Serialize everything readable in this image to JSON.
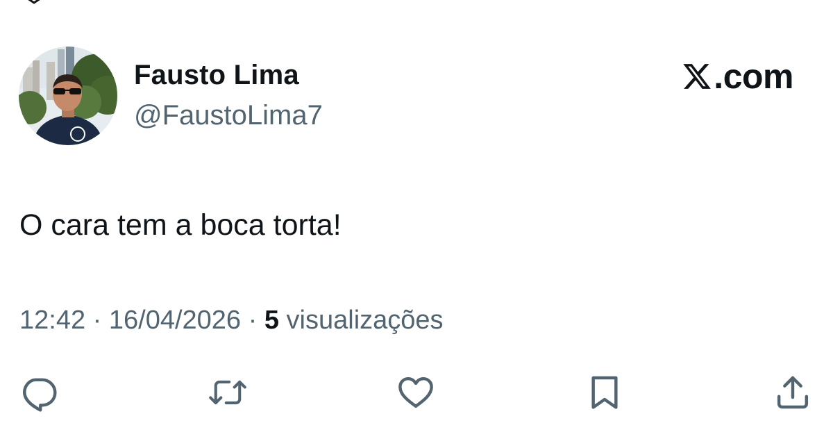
{
  "author": {
    "display_name": "Fausto Lima",
    "handle": "@FaustoLima7"
  },
  "brand": {
    "text": ".com",
    "icon": "x-logo-icon"
  },
  "tweet": {
    "text": "O cara tem a boca torta!"
  },
  "meta": {
    "time": "12:42",
    "separator": "·",
    "date": "16/04/2026",
    "views_count": "5",
    "views_label": "visualizações"
  },
  "actions": [
    {
      "name": "reply",
      "icon": "reply-icon"
    },
    {
      "name": "retweet",
      "icon": "retweet-icon"
    },
    {
      "name": "like",
      "icon": "heart-icon"
    },
    {
      "name": "bookmark",
      "icon": "bookmark-icon"
    },
    {
      "name": "share",
      "icon": "share-icon"
    }
  ],
  "colors": {
    "text_primary": "#0f1419",
    "text_secondary": "#536471",
    "background": "#ffffff"
  }
}
